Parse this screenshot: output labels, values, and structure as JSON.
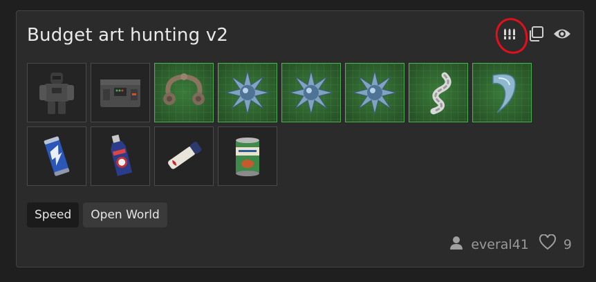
{
  "build": {
    "title": "Budget art hunting v2",
    "actions": [
      {
        "name": "ammo-icon",
        "highlighted": true
      },
      {
        "name": "copy-icon"
      },
      {
        "name": "eye-icon"
      }
    ],
    "items_row1": [
      {
        "name": "exoskeleton-armor",
        "artifact": false
      },
      {
        "name": "container-case",
        "artifact": false
      },
      {
        "name": "artifact-claw-ring",
        "artifact": true
      },
      {
        "name": "artifact-spiky-blue",
        "artifact": true
      },
      {
        "name": "artifact-spiky-blue",
        "artifact": true
      },
      {
        "name": "artifact-spiky-blue",
        "artifact": true
      },
      {
        "name": "artifact-twisted-shell",
        "artifact": true
      },
      {
        "name": "artifact-crystal-fang",
        "artifact": true
      }
    ],
    "items_row2": [
      {
        "name": "energy-drink-can",
        "artifact": false
      },
      {
        "name": "medical-bottle",
        "artifact": false
      },
      {
        "name": "injector-tube",
        "artifact": false
      },
      {
        "name": "canned-beans",
        "artifact": false
      }
    ],
    "tags": [
      {
        "label": "Speed",
        "style": "dark"
      },
      {
        "label": "Open World",
        "style": "light"
      }
    ],
    "author": "everal41",
    "likes": "9",
    "colors": {
      "background": "#1f1f1f",
      "card": "#2b2b2b",
      "artifact_slot": "#2e5f2e",
      "artifact_border": "#4caf50",
      "highlight": "#e3101c"
    }
  }
}
